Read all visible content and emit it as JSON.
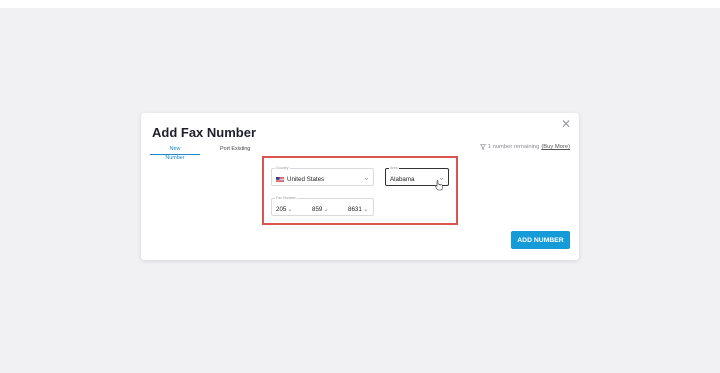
{
  "modal": {
    "title": "Add Fax Number",
    "close_icon": "close-icon"
  },
  "tabs": [
    {
      "label": "New Number",
      "active": true
    },
    {
      "label": "Port Existing",
      "active": false
    }
  ],
  "remaining": {
    "text": "1 number remaining",
    "link": "(Buy More)",
    "icon": "filter-icon"
  },
  "form": {
    "country": {
      "label": "Country",
      "value": "United States",
      "flag_icon": "us-flag-icon"
    },
    "area": {
      "label": "Area",
      "value": "Alabama"
    },
    "fax_number": {
      "label": "Fax Number",
      "parts": [
        "205",
        "859",
        "8631"
      ]
    }
  },
  "actions": {
    "add_label": "ADD NUMBER"
  },
  "colors": {
    "accent": "#159bd7",
    "highlight": "#d9554f",
    "background": "#f1f1f4"
  }
}
